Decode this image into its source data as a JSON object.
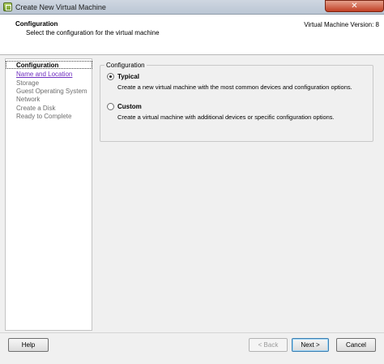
{
  "window": {
    "title": "Create New Virtual Machine",
    "close_label": "✕"
  },
  "header": {
    "title": "Configuration",
    "subtitle": "Select the configuration for the virtual machine",
    "version": "Virtual Machine Version: 8"
  },
  "steps": [
    {
      "label": "Configuration",
      "state": "current"
    },
    {
      "label": "Name and Location",
      "state": "link"
    },
    {
      "label": "Storage",
      "state": "pending"
    },
    {
      "label": "Guest Operating System",
      "state": "pending"
    },
    {
      "label": "Network",
      "state": "pending"
    },
    {
      "label": "Create a Disk",
      "state": "pending"
    },
    {
      "label": "Ready to Complete",
      "state": "pending"
    }
  ],
  "configuration": {
    "legend": "Configuration",
    "options": [
      {
        "label": "Typical",
        "description": "Create a new virtual machine with the most common devices and configuration options.",
        "checked": true
      },
      {
        "label": "Custom",
        "description": "Create a virtual machine with additional devices or specific configuration options.",
        "checked": false
      }
    ]
  },
  "footer": {
    "help": "Help",
    "back": "< Back",
    "next": "Next >",
    "cancel": "Cancel"
  }
}
